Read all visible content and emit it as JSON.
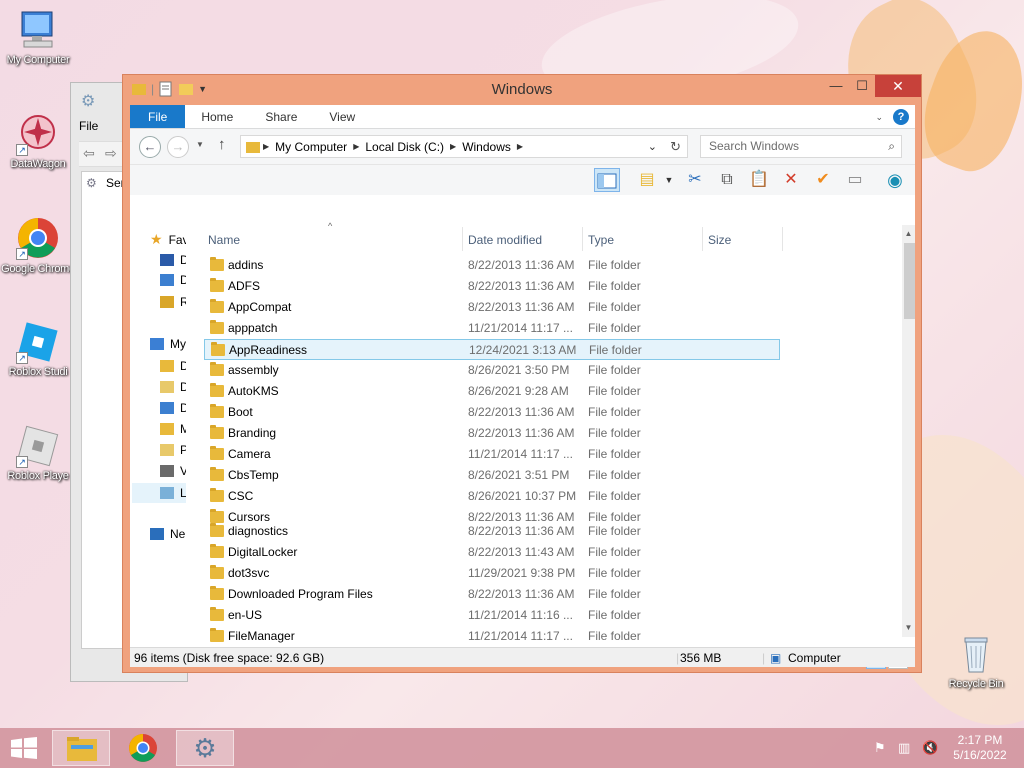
{
  "desktop": {
    "icons": [
      {
        "label": "My Computer",
        "icon": "computer-icon"
      },
      {
        "label": "DataWagon",
        "icon": "datawagon-icon"
      },
      {
        "label": "Google Chrome",
        "icon": "chrome-icon"
      },
      {
        "label": "Roblox Studi",
        "icon": "roblox-studio-icon"
      },
      {
        "label": "Roblox Playe",
        "icon": "roblox-player-icon"
      },
      {
        "label": "Recycle Bin",
        "icon": "recycle-bin-icon"
      }
    ]
  },
  "bg_window": {
    "file_label": "File",
    "search_label": "Ser"
  },
  "window": {
    "title": "Windows",
    "tabs": [
      "File",
      "Home",
      "Share",
      "View"
    ],
    "address": {
      "segments": [
        "My Computer",
        "Local Disk (C:)",
        "Windows"
      ]
    },
    "search_placeholder": "Search Windows",
    "nav_pane": {
      "items": [
        {
          "label": "Fav",
          "icon": "star-icon"
        },
        {
          "label": "D",
          "icon": "desktop-icon"
        },
        {
          "label": "D",
          "icon": "downloads-icon"
        },
        {
          "label": "R",
          "icon": "recent-icon"
        },
        {
          "label": "My",
          "icon": "computer-icon"
        },
        {
          "label": "D",
          "icon": "folder-icon"
        },
        {
          "label": "D",
          "icon": "documents-icon"
        },
        {
          "label": "D",
          "icon": "downloads-icon"
        },
        {
          "label": "M",
          "icon": "music-icon"
        },
        {
          "label": "P",
          "icon": "pictures-icon"
        },
        {
          "label": "V",
          "icon": "videos-icon"
        },
        {
          "label": "L",
          "icon": "drive-icon"
        },
        {
          "label": "Ne",
          "icon": "network-icon"
        }
      ]
    },
    "columns": [
      "Name",
      "Date modified",
      "Type",
      "Size"
    ],
    "files": [
      {
        "name": "addins",
        "date": "8/22/2013 11:36 AM",
        "type": "File folder"
      },
      {
        "name": "ADFS",
        "date": "8/22/2013 11:36 AM",
        "type": "File folder"
      },
      {
        "name": "AppCompat",
        "date": "8/22/2013 11:36 AM",
        "type": "File folder"
      },
      {
        "name": "apppatch",
        "date": "11/21/2014 11:17 ...",
        "type": "File folder"
      },
      {
        "name": "AppReadiness",
        "date": "12/24/2021 3:13 AM",
        "type": "File folder",
        "selected": true
      },
      {
        "name": "assembly",
        "date": "8/26/2021 3:50 PM",
        "type": "File folder"
      },
      {
        "name": "AutoKMS",
        "date": "8/26/2021 9:28 AM",
        "type": "File folder"
      },
      {
        "name": "Boot",
        "date": "8/22/2013 11:36 AM",
        "type": "File folder"
      },
      {
        "name": "Branding",
        "date": "8/22/2013 11:36 AM",
        "type": "File folder"
      },
      {
        "name": "Camera",
        "date": "11/21/2014 11:17 ...",
        "type": "File folder"
      },
      {
        "name": "CbsTemp",
        "date": "8/26/2021 3:51 PM",
        "type": "File folder"
      },
      {
        "name": "CSC",
        "date": "8/26/2021 10:37 PM",
        "type": "File folder"
      },
      {
        "name": "Cursors",
        "date": "8/22/2013 11:36 AM",
        "type": "File folder"
      },
      {
        "name": "diagnostics",
        "date": "8/22/2013 11:36 AM",
        "type": "File folder"
      },
      {
        "name": "DigitalLocker",
        "date": "8/22/2013 11:43 AM",
        "type": "File folder"
      },
      {
        "name": "dot3svc",
        "date": "11/29/2021 9:38 PM",
        "type": "File folder"
      },
      {
        "name": "Downloaded Program Files",
        "date": "8/22/2013 11:36 AM",
        "type": "File folder"
      },
      {
        "name": "en-US",
        "date": "11/21/2014 11:16 ...",
        "type": "File folder"
      },
      {
        "name": "FileManager",
        "date": "11/21/2014 11:17 ...",
        "type": "File folder"
      }
    ],
    "items_count": "96 items",
    "status": {
      "left": "96 items (Disk free space: 92.6 GB)",
      "size": "356 MB",
      "location": "Computer"
    }
  },
  "taskbar": {
    "time": "2:17 PM",
    "date": "5/16/2022",
    "items": [
      "file-explorer-icon",
      "chrome-icon",
      "settings-gear-icon"
    ]
  },
  "colors": {
    "window_frame": "#f0a27e",
    "file_tab": "#1979ca",
    "close_button": "#c7413a",
    "taskbar": "#d296a0",
    "selection": "#e5f3fb"
  }
}
